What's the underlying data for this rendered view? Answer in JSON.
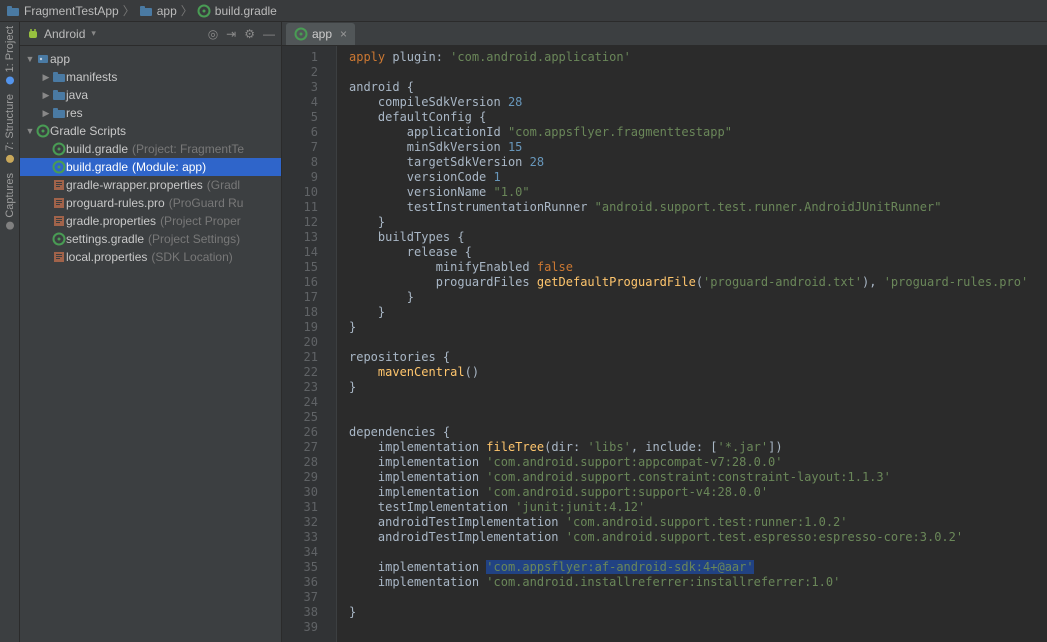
{
  "breadcrumbs": [
    {
      "icon": "folder",
      "label": "FragmentTestApp"
    },
    {
      "icon": "folder",
      "label": "app"
    },
    {
      "icon": "gradle",
      "label": "build.gradle"
    }
  ],
  "toolstrip": {
    "project": "1: Project",
    "structure": "7: Structure",
    "captures": "Captures"
  },
  "projectPanel": {
    "mode": "Android",
    "tree": [
      {
        "ind": 0,
        "arrow": "▼",
        "icon": "module",
        "label": "app",
        "sel": false
      },
      {
        "ind": 1,
        "arrow": "▶",
        "icon": "folder",
        "label": "manifests",
        "sel": false
      },
      {
        "ind": 1,
        "arrow": "▶",
        "icon": "folder",
        "label": "java",
        "sel": false
      },
      {
        "ind": 1,
        "arrow": "▶",
        "icon": "folder",
        "label": "res",
        "sel": false
      },
      {
        "ind": 0,
        "arrow": "▼",
        "icon": "gradle",
        "label": "Gradle Scripts",
        "sel": false
      },
      {
        "ind": 1,
        "arrow": "",
        "icon": "gradle",
        "label": "build.gradle",
        "hint": "(Project: FragmentTe",
        "sel": false
      },
      {
        "ind": 1,
        "arrow": "",
        "icon": "gradle",
        "label": "build.gradle",
        "hint": "(Module: app)",
        "sel": true
      },
      {
        "ind": 1,
        "arrow": "",
        "icon": "props",
        "label": "gradle-wrapper.properties",
        "hint": "(Gradl",
        "sel": false
      },
      {
        "ind": 1,
        "arrow": "",
        "icon": "props",
        "label": "proguard-rules.pro",
        "hint": "(ProGuard Ru",
        "sel": false
      },
      {
        "ind": 1,
        "arrow": "",
        "icon": "props",
        "label": "gradle.properties",
        "hint": "(Project Proper",
        "sel": false
      },
      {
        "ind": 1,
        "arrow": "",
        "icon": "gradle",
        "label": "settings.gradle",
        "hint": "(Project Settings)",
        "sel": false
      },
      {
        "ind": 1,
        "arrow": "",
        "icon": "props",
        "label": "local.properties",
        "hint": "(SDK Location)",
        "sel": false
      }
    ]
  },
  "editor": {
    "tab": {
      "icon": "gradle",
      "label": "app"
    },
    "lines": [
      [
        [
          "kw",
          "apply "
        ],
        [
          "fn",
          "plugin"
        ],
        [
          "pln",
          ": "
        ],
        [
          "str",
          "'com.android.application'"
        ]
      ],
      [],
      [
        [
          "fn",
          "android "
        ],
        [
          "pln",
          "{"
        ]
      ],
      [
        [
          "pln",
          "    "
        ],
        [
          "fn",
          "compileSdkVersion "
        ],
        [
          "num",
          "28"
        ]
      ],
      [
        [
          "pln",
          "    "
        ],
        [
          "fn",
          "defaultConfig "
        ],
        [
          "pln",
          "{"
        ]
      ],
      [
        [
          "pln",
          "        "
        ],
        [
          "fn",
          "applicationId "
        ],
        [
          "str",
          "\"com.appsflyer.fragmenttestapp\""
        ]
      ],
      [
        [
          "pln",
          "        "
        ],
        [
          "fn",
          "minSdkVersion "
        ],
        [
          "num",
          "15"
        ]
      ],
      [
        [
          "pln",
          "        "
        ],
        [
          "fn",
          "targetSdkVersion "
        ],
        [
          "num",
          "28"
        ]
      ],
      [
        [
          "pln",
          "        "
        ],
        [
          "fn",
          "versionCode "
        ],
        [
          "num",
          "1"
        ]
      ],
      [
        [
          "pln",
          "        "
        ],
        [
          "fn",
          "versionName "
        ],
        [
          "str",
          "\"1.0\""
        ]
      ],
      [
        [
          "pln",
          "        "
        ],
        [
          "fn",
          "testInstrumentationRunner "
        ],
        [
          "str",
          "\"android.support.test.runner.AndroidJUnitRunner\""
        ]
      ],
      [
        [
          "pln",
          "    }"
        ]
      ],
      [
        [
          "pln",
          "    "
        ],
        [
          "fn",
          "buildTypes "
        ],
        [
          "pln",
          "{"
        ]
      ],
      [
        [
          "pln",
          "        "
        ],
        [
          "fn",
          "release "
        ],
        [
          "pln",
          "{"
        ]
      ],
      [
        [
          "pln",
          "            "
        ],
        [
          "fn",
          "minifyEnabled "
        ],
        [
          "kw",
          "false"
        ]
      ],
      [
        [
          "pln",
          "            "
        ],
        [
          "fn",
          "proguardFiles "
        ],
        [
          "id",
          "getDefaultProguardFile"
        ],
        [
          "pln",
          "("
        ],
        [
          "str",
          "'proguard-android.txt'"
        ],
        [
          "pln",
          "), "
        ],
        [
          "str",
          "'proguard-rules.pro'"
        ]
      ],
      [
        [
          "pln",
          "        }"
        ]
      ],
      [
        [
          "pln",
          "    }"
        ]
      ],
      [
        [
          "pln",
          "}"
        ]
      ],
      [],
      [
        [
          "fn",
          "repositories "
        ],
        [
          "pln",
          "{"
        ]
      ],
      [
        [
          "pln",
          "    "
        ],
        [
          "id",
          "mavenCentral"
        ],
        [
          "pln",
          "()"
        ]
      ],
      [
        [
          "pln",
          "}"
        ]
      ],
      [],
      [],
      [
        [
          "fn",
          "dependencies "
        ],
        [
          "pln",
          "{"
        ]
      ],
      [
        [
          "pln",
          "    "
        ],
        [
          "fn",
          "implementation "
        ],
        [
          "id",
          "fileTree"
        ],
        [
          "pln",
          "("
        ],
        [
          "fn",
          "dir"
        ],
        [
          "pln",
          ": "
        ],
        [
          "str",
          "'libs'"
        ],
        [
          "pln",
          ", "
        ],
        [
          "fn",
          "include"
        ],
        [
          "pln",
          ": ["
        ],
        [
          "str",
          "'*.jar'"
        ],
        [
          "pln",
          "])"
        ]
      ],
      [
        [
          "pln",
          "    "
        ],
        [
          "fn",
          "implementation "
        ],
        [
          "str",
          "'com.android.support:appcompat-v7:28.0.0'"
        ]
      ],
      [
        [
          "pln",
          "    "
        ],
        [
          "fn",
          "implementation "
        ],
        [
          "str",
          "'com.android.support.constraint:constraint-layout:1.1.3'"
        ]
      ],
      [
        [
          "pln",
          "    "
        ],
        [
          "fn",
          "implementation "
        ],
        [
          "str",
          "'com.android.support:support-v4:28.0.0'"
        ]
      ],
      [
        [
          "pln",
          "    "
        ],
        [
          "fn",
          "testImplementation "
        ],
        [
          "str",
          "'junit:junit:4.12'"
        ]
      ],
      [
        [
          "pln",
          "    "
        ],
        [
          "fn",
          "androidTestImplementation "
        ],
        [
          "str",
          "'com.android.support.test:runner:1.0.2'"
        ]
      ],
      [
        [
          "pln",
          "    "
        ],
        [
          "fn",
          "androidTestImplementation "
        ],
        [
          "str",
          "'com.android.support.test.espresso:espresso-core:3.0.2'"
        ]
      ],
      [],
      [
        [
          "pln",
          "    "
        ],
        [
          "fn",
          "implementation "
        ],
        [
          "str hl",
          "'com.appsflyer:af-android-sdk:4+@aar'"
        ]
      ],
      [
        [
          "pln",
          "    "
        ],
        [
          "fn",
          "implementation "
        ],
        [
          "str",
          "'com.android.installreferrer:installreferrer:1.0'"
        ]
      ],
      [],
      [
        [
          "pln",
          "}"
        ]
      ],
      []
    ]
  }
}
